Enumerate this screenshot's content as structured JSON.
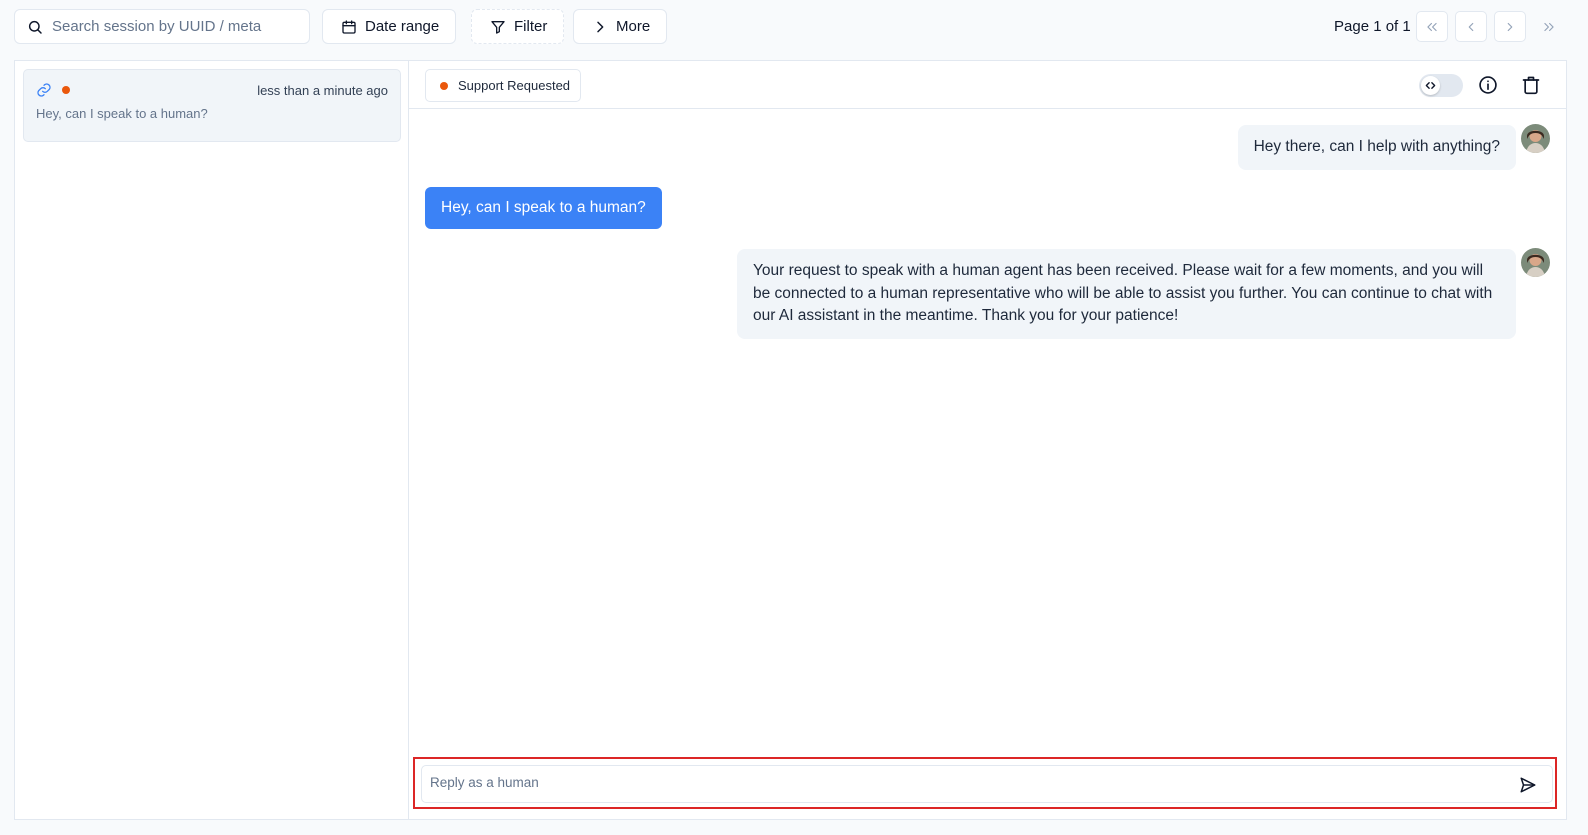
{
  "toolbar": {
    "search_placeholder": "Search session by UUID / meta",
    "date_range_label": "Date range",
    "filter_label": "Filter",
    "more_label": "More"
  },
  "pagination": {
    "label": "Page 1 of 1",
    "current_page": 1,
    "total_pages": 1
  },
  "sessions": [
    {
      "time": "less than a minute ago",
      "preview": "Hey, can I speak to a human?",
      "status_color": "#ea580c"
    }
  ],
  "conversation": {
    "status_label": "Support Requested",
    "status_color": "#ea580c",
    "messages": [
      {
        "role": "assistant",
        "text": "Hey there, can I help with anything?"
      },
      {
        "role": "user",
        "text": "Hey, can I speak to a human?"
      },
      {
        "role": "assistant",
        "text": "Your request to speak with a human agent has been received. Please wait for a few moments, and you will be connected to a human representative who will be able to assist you further. You can continue to chat with our AI assistant in the meantime. Thank you for your patience!"
      }
    ]
  },
  "composer": {
    "placeholder": "Reply as a human"
  },
  "icons": {
    "search": "search-icon",
    "calendar": "calendar-icon",
    "filter": "filter-icon",
    "more": "chevron-right-icon",
    "link": "link-icon",
    "code_toggle": "code-icon",
    "info": "info-icon",
    "delete": "trash-icon",
    "send": "send-icon"
  },
  "colors": {
    "accent": "#3b82f6",
    "status": "#ea580c",
    "highlight": "#dc2626"
  }
}
